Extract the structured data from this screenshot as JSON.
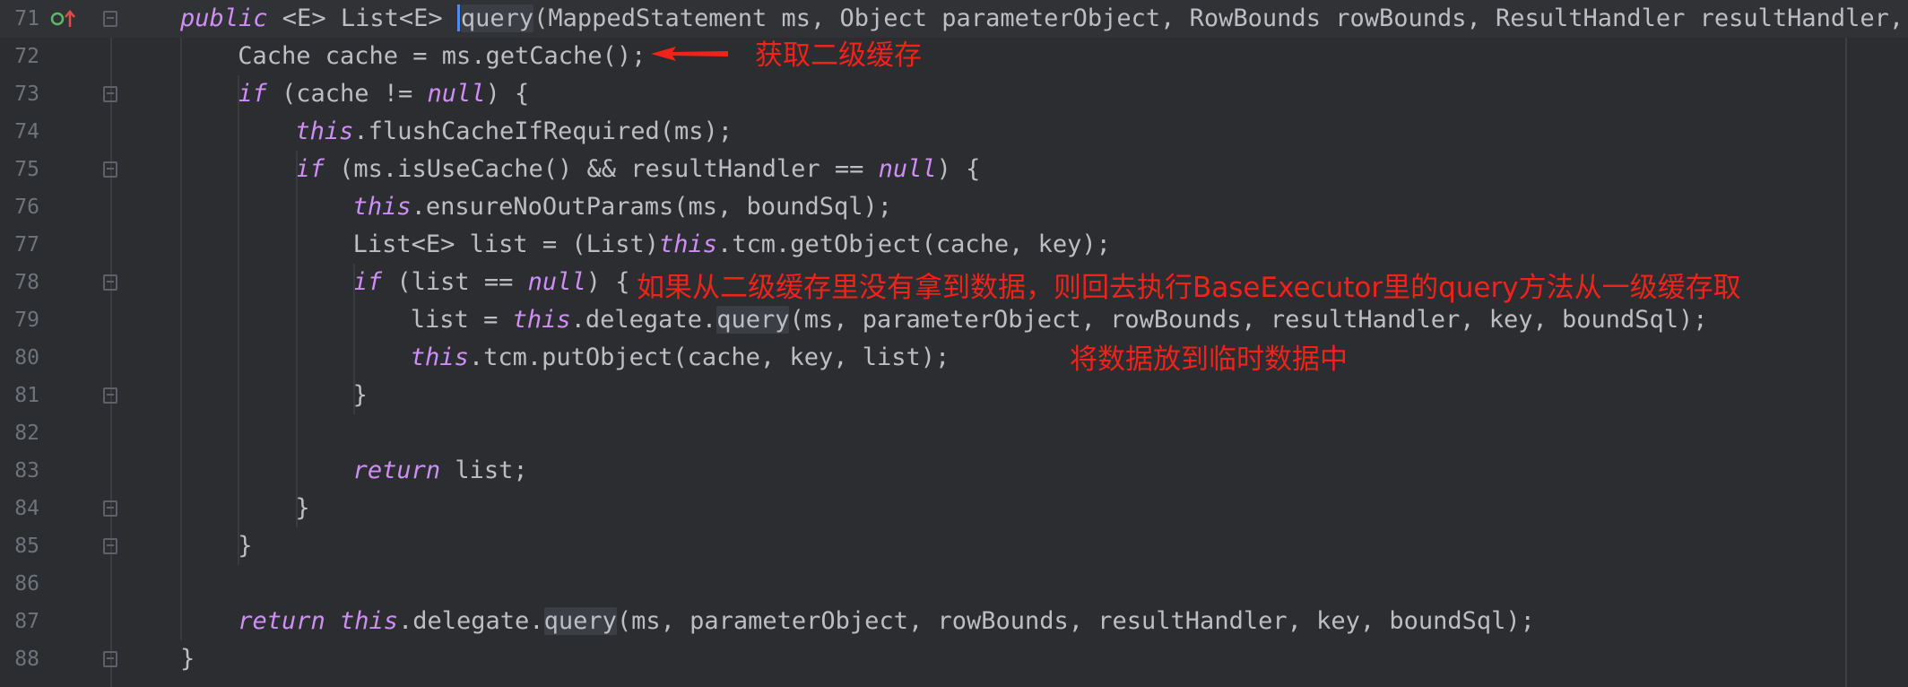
{
  "editor": {
    "lines": [
      {
        "no": "71",
        "indent": 3,
        "current": true,
        "tokens": [
          {
            "k": "kw",
            "t": "public"
          },
          {
            "t": " <E> List<E> "
          },
          {
            "k": "caret"
          },
          {
            "k": "qhl",
            "t": "query"
          },
          {
            "t": "(MappedStatement ms, Object parameterObject, RowBounds rowBounds, ResultHandler resultHandler, Ca"
          }
        ]
      },
      {
        "no": "72",
        "indent": 4,
        "tokens": [
          {
            "t": "Cache cache = ms.getCache();"
          }
        ]
      },
      {
        "no": "73",
        "indent": 4,
        "tokens": [
          {
            "k": "kw",
            "t": "if"
          },
          {
            "t": " (cache != "
          },
          {
            "k": "kw",
            "t": "null"
          },
          {
            "t": ") {"
          }
        ]
      },
      {
        "no": "74",
        "indent": 5,
        "tokens": [
          {
            "k": "kw",
            "t": "this"
          },
          {
            "t": ".flushCacheIfRequired(ms);"
          }
        ]
      },
      {
        "no": "75",
        "indent": 5,
        "tokens": [
          {
            "k": "kw",
            "t": "if"
          },
          {
            "t": " (ms.isUseCache() && resultHandler == "
          },
          {
            "k": "kw",
            "t": "null"
          },
          {
            "t": ") {"
          }
        ]
      },
      {
        "no": "76",
        "indent": 6,
        "tokens": [
          {
            "k": "kw",
            "t": "this"
          },
          {
            "t": ".ensureNoOutParams(ms, boundSql);"
          }
        ]
      },
      {
        "no": "77",
        "indent": 6,
        "tokens": [
          {
            "t": "List<E> list = (List)"
          },
          {
            "k": "kw",
            "t": "this"
          },
          {
            "t": ".tcm.getObject(cache, key);"
          }
        ]
      },
      {
        "no": "78",
        "indent": 6,
        "tokens": [
          {
            "k": "kw",
            "t": "if"
          },
          {
            "t": " (list == "
          },
          {
            "k": "kw",
            "t": "null"
          },
          {
            "t": ") {"
          }
        ]
      },
      {
        "no": "79",
        "indent": 7,
        "tokens": [
          {
            "t": "list = "
          },
          {
            "k": "kw",
            "t": "this"
          },
          {
            "t": ".delegate."
          },
          {
            "k": "qhl",
            "t": "query"
          },
          {
            "t": "(ms, parameterObject, rowBounds, resultHandler, key, boundSql);"
          }
        ]
      },
      {
        "no": "80",
        "indent": 7,
        "tokens": [
          {
            "k": "kw",
            "t": "this"
          },
          {
            "t": ".tcm.putObject(cache, key, list);"
          }
        ]
      },
      {
        "no": "81",
        "indent": 6,
        "tokens": [
          {
            "t": "}"
          }
        ]
      },
      {
        "no": "82",
        "indent": 6,
        "tokens": []
      },
      {
        "no": "83",
        "indent": 6,
        "tokens": [
          {
            "k": "kw",
            "t": "return"
          },
          {
            "t": " list;"
          }
        ]
      },
      {
        "no": "84",
        "indent": 5,
        "tokens": [
          {
            "t": "}"
          }
        ]
      },
      {
        "no": "85",
        "indent": 4,
        "tokens": [
          {
            "t": "}"
          }
        ]
      },
      {
        "no": "86",
        "indent": 4,
        "tokens": []
      },
      {
        "no": "87",
        "indent": 4,
        "tokens": [
          {
            "k": "kw",
            "t": "return this"
          },
          {
            "t": ".delegate."
          },
          {
            "k": "qhl",
            "t": "query"
          },
          {
            "t": "(ms, parameterObject, rowBounds, resultHandler, key, boundSql);"
          }
        ]
      },
      {
        "no": "88",
        "indent": 3,
        "tokens": [
          {
            "t": "}"
          }
        ]
      }
    ],
    "gutter_icons": [
      "override-up-arrow-icon"
    ]
  },
  "annotations": {
    "second_level_cache": "获取二级缓存",
    "fallback_query": "如果从二级缓存里没有拿到数据，则回去执行BaseExecutor里的query方法从一级缓存取",
    "put_temp": "将数据放到临时数据中"
  },
  "colors": {
    "background": "#2b2d30",
    "keyword": "#cf8ef4",
    "text": "#bcbec4",
    "line_number": "#6f737a",
    "annotation": "#f0221a",
    "caret": "#4c8cf5"
  }
}
